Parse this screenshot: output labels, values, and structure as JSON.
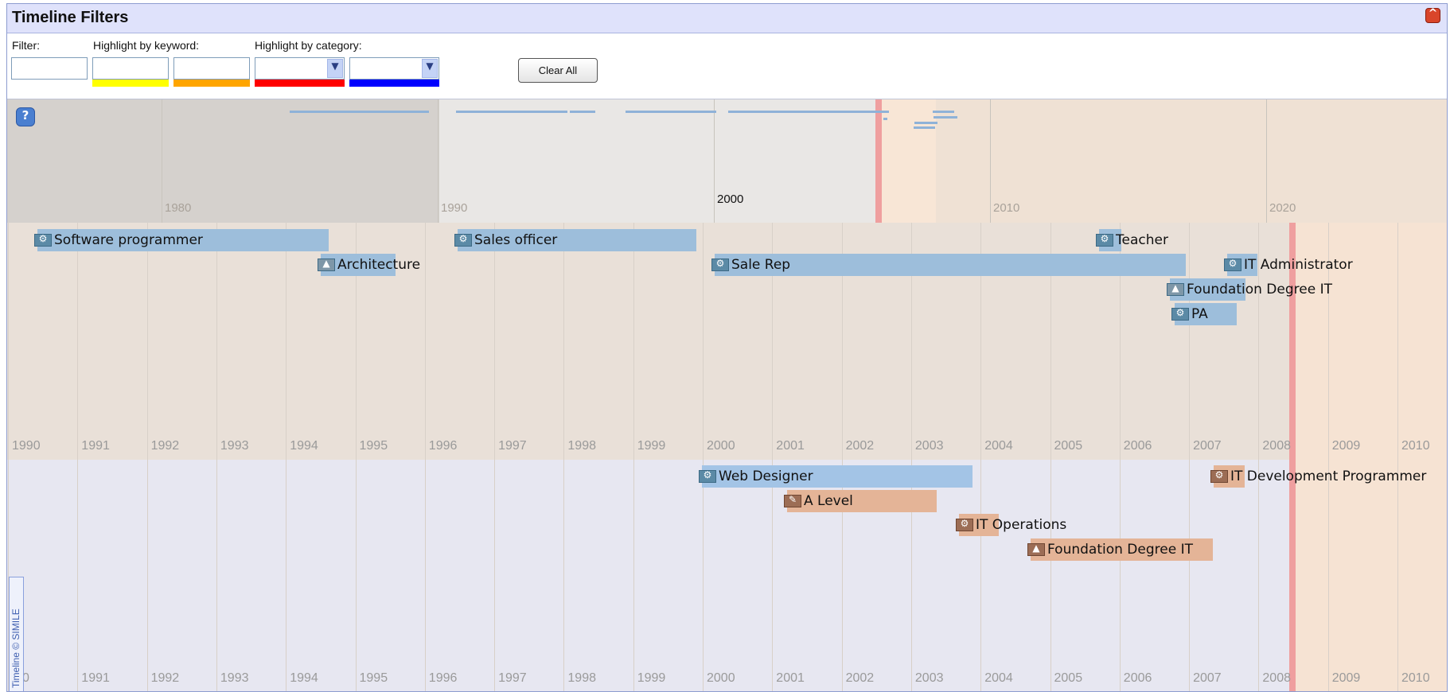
{
  "header": {
    "title": "Timeline Filters"
  },
  "filters": {
    "filter_label": "Filter:",
    "keyword_label": "Highlight by keyword:",
    "category_label": "Highlight by category:",
    "filter_value": "",
    "keyword1_value": "",
    "keyword2_value": "",
    "keyword1_color": "#ffff00",
    "keyword2_color": "#ffa500",
    "category1_value": "",
    "category2_value": "",
    "category1_color": "#ff0000",
    "category2_color": "#0000ff",
    "clear_label": "Clear All"
  },
  "overview": {
    "decade_labels": [
      "1980",
      "1990",
      "2000",
      "2010",
      "2020"
    ],
    "center_label": "2000"
  },
  "year_labels": [
    "1990",
    "1991",
    "1992",
    "1993",
    "1994",
    "1995",
    "1996",
    "1997",
    "1998",
    "1999",
    "2000",
    "2001",
    "2002",
    "2003",
    "2004",
    "2005",
    "2006",
    "2007",
    "2008",
    "2009",
    "2010"
  ],
  "band_bottom_first_label": "0",
  "events_top": [
    {
      "label": "Software programmer",
      "icon": "gear-icon"
    },
    {
      "label": "Architecture",
      "icon": "graduation-cap-icon"
    },
    {
      "label": "Sales officer",
      "icon": "gear-icon"
    },
    {
      "label": "Sale Rep",
      "icon": "gear-icon"
    },
    {
      "label": "Teacher",
      "icon": "gear-icon"
    },
    {
      "label": "IT Administrator",
      "icon": "gear-icon"
    },
    {
      "label": "Foundation Degree IT",
      "icon": "graduation-cap-icon"
    },
    {
      "label": "PA",
      "icon": "gear-icon"
    }
  ],
  "events_bottom": [
    {
      "label": "Web Designer",
      "icon": "gear-icon"
    },
    {
      "label": "A Level",
      "icon": "diploma-icon"
    },
    {
      "label": "IT Operations",
      "icon": "gear-icon"
    },
    {
      "label": "Foundation Degree IT",
      "icon": "graduation-cap-icon"
    },
    {
      "label": "IT Development Programmer",
      "icon": "gear-icon"
    }
  ],
  "credit": "Timeline © SIMILE",
  "help_symbol": "?",
  "collapse_symbol": "^"
}
